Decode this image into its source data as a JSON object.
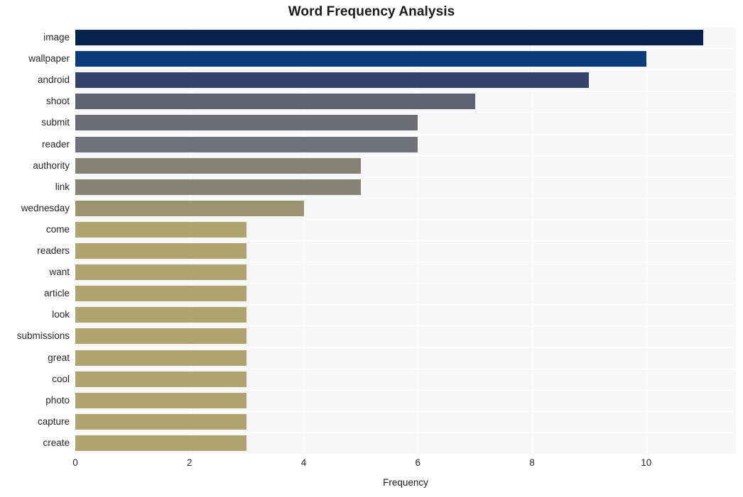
{
  "chart_data": {
    "type": "bar",
    "orientation": "horizontal",
    "title": "Word Frequency Analysis",
    "xlabel": "Frequency",
    "ylabel": "",
    "categories": [
      "image",
      "wallpaper",
      "android",
      "shoot",
      "submit",
      "reader",
      "authority",
      "link",
      "wednesday",
      "come",
      "readers",
      "want",
      "article",
      "look",
      "submissions",
      "great",
      "cool",
      "photo",
      "capture",
      "create"
    ],
    "values": [
      11,
      10,
      9,
      7,
      6,
      6,
      5,
      5,
      4,
      3,
      3,
      3,
      3,
      3,
      3,
      3,
      3,
      3,
      3,
      3
    ],
    "bar_colors": [
      "#07234d",
      "#0a3b7c",
      "#334269",
      "#5e6273",
      "#6d6e74",
      "#717277",
      "#848376",
      "#868477",
      "#9c9470",
      "#b0a46e",
      "#b0a46e",
      "#b0a46e",
      "#b0a46e",
      "#b0a46e",
      "#b0a46e",
      "#b0a46e",
      "#b0a46e",
      "#b0a46e",
      "#b0a46e",
      "#b0a46e"
    ],
    "xlim": [
      0,
      11.57
    ],
    "xticks": [
      0,
      2,
      4,
      6,
      8,
      10
    ],
    "xtick_labels": [
      "0",
      "2",
      "4",
      "6",
      "8",
      "10"
    ],
    "grid": true,
    "grid_color": "#ffffff",
    "plot_background": "#f7f7f7",
    "figure_background": "#ffffff",
    "legend": null
  }
}
